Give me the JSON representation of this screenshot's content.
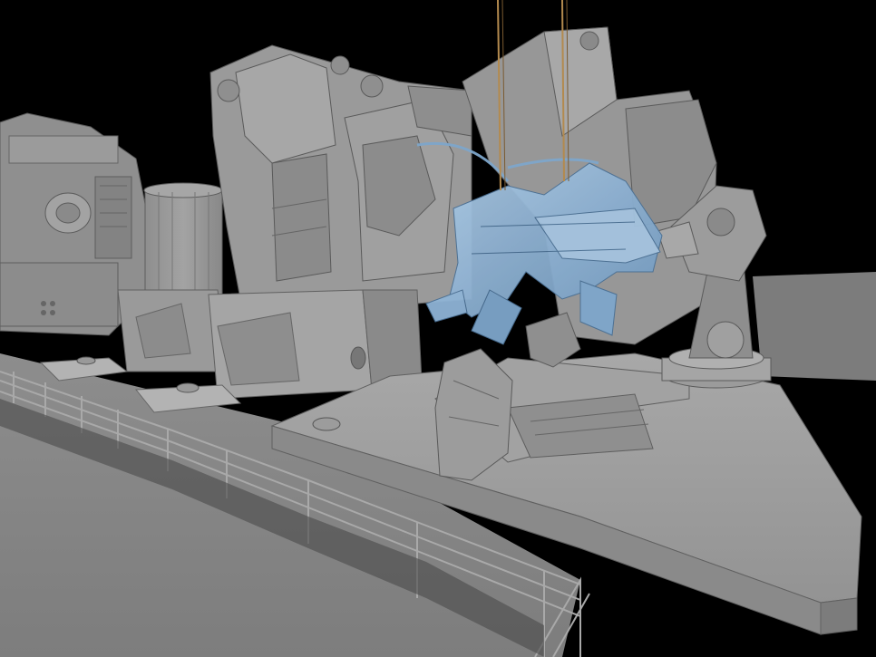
{
  "scene": {
    "background_color": "#000000",
    "floor_color": "#8a8a8a",
    "machinery_color": "#9a9a9a",
    "machinery_shadow_color": "#6e6e6e",
    "highlight_color": "#b8b8b8",
    "selected_object_color": "#8fb4d6",
    "cable_color": "#b38a4e",
    "railing_color": "#a8a8a8"
  }
}
